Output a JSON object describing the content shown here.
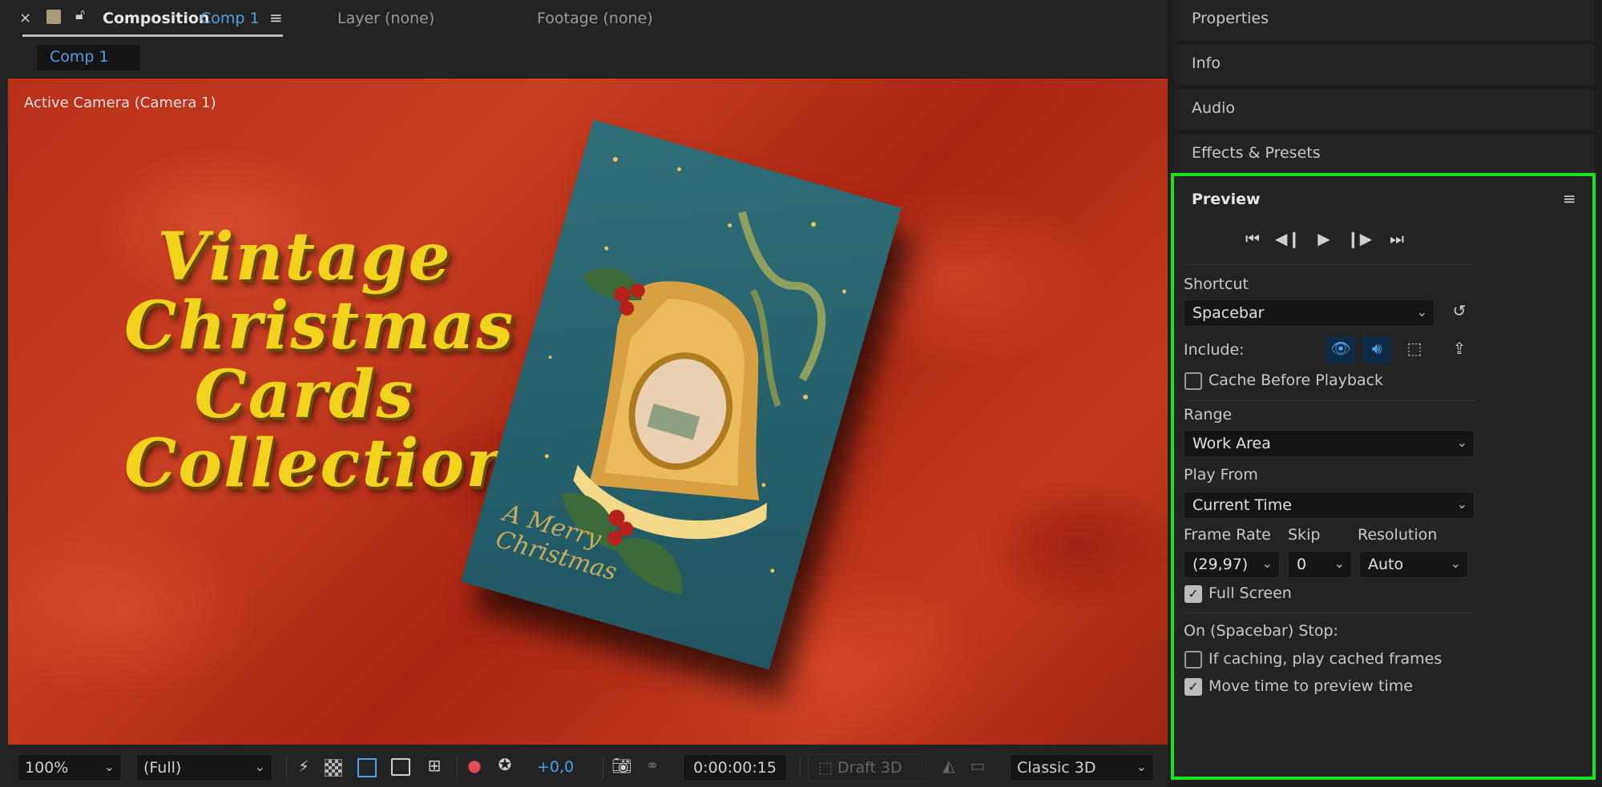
{
  "tabs": {
    "composition_label": "Composition",
    "composition_name": "Comp 1",
    "layer": "Layer (none)",
    "footage": "Footage (none)",
    "comp_chip": "Comp 1"
  },
  "viewer": {
    "camera_label": "Active Camera (Camera 1)",
    "title_lines": [
      "Vintage",
      "Christmas",
      "Cards",
      "Collection"
    ],
    "card_caption_1": "A Merry",
    "card_caption_2": "Christmas"
  },
  "bottombar": {
    "zoom": "100%",
    "resolution": "(Full)",
    "exposure": "+0,0",
    "timecode": "0:00:00:15",
    "draft3d": "Draft 3D",
    "renderer": "Classic 3D"
  },
  "right_panels": {
    "properties": "Properties",
    "info": "Info",
    "audio": "Audio",
    "effects": "Effects & Presets"
  },
  "preview": {
    "title": "Preview",
    "shortcut_label": "Shortcut",
    "shortcut_value": "Spacebar",
    "include_label": "Include:",
    "cache_before_playback": "Cache Before Playback",
    "range_label": "Range",
    "range_value": "Work Area",
    "play_from_label": "Play From",
    "play_from_value": "Current Time",
    "frame_rate_label": "Frame Rate",
    "skip_label": "Skip",
    "resolution_label": "Resolution",
    "frame_rate_value": "(29,97)",
    "skip_value": "0",
    "resolution_value": "Auto",
    "full_screen": "Full Screen",
    "on_stop_label": "On (Spacebar) Stop:",
    "if_caching": "If caching, play cached frames",
    "move_time": "Move time to preview time"
  },
  "colors": {
    "accent_blue": "#4d9fe6",
    "highlight_green": "#18e218",
    "title_gold": "#f2d21c"
  }
}
